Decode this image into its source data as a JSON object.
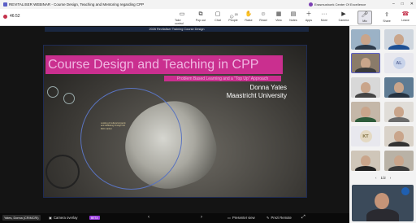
{
  "titlebar": {
    "title": "REVITALISER WEBINAR - Course Design, Teaching and Mentoring regarding CPP",
    "org": "Erasmushoek Center Of Excellence",
    "window_buttons": [
      "–",
      "□",
      "✕"
    ]
  },
  "toolbar": {
    "timer": "46:52",
    "buttons": [
      {
        "label": "Take control",
        "icon": "monitor-icon"
      },
      {
        "label": "Pop out",
        "icon": "popout-icon"
      },
      {
        "label": "Chat",
        "icon": "chat-icon"
      },
      {
        "label": "People",
        "icon": "people-icon",
        "count": "18"
      },
      {
        "label": "Raise",
        "icon": "hand-icon"
      },
      {
        "label": "React",
        "icon": "emoji-icon"
      },
      {
        "label": "View",
        "icon": "grid-icon"
      },
      {
        "label": "Notes",
        "icon": "notes-icon"
      },
      {
        "label": "Apps",
        "icon": "apps-icon"
      },
      {
        "label": "More",
        "icon": "more-icon"
      },
      {
        "label": "Camera",
        "icon": "camera-icon"
      },
      {
        "label": "Mic",
        "icon": "mic-icon"
      },
      {
        "label": "Share",
        "icon": "share-icon"
      },
      {
        "label": "Leave",
        "icon": "phone-icon"
      }
    ]
  },
  "slide": {
    "header": "2026 Revitaliser Training Course Design",
    "title": "Course Design and Teaching in CPP",
    "subtitle": "Problem Based Learning and a \"Top Up\" Approach",
    "speaker_name": "Donna Yates",
    "speaker_affiliation": "Maastricht University",
    "callout": "Looting of cultural property and trafficking through the illicit market"
  },
  "bottom": {
    "presenter_name": "Yates, Donna (CRIMCRI)",
    "camera_overlay": "Camera overlay",
    "beta": "BETA",
    "presenter_view": "Presenter view",
    "prezi_remote": "Prezi Remote"
  },
  "participants": {
    "initials_1": "AL",
    "initials_2": "KT",
    "page": "1/2"
  },
  "colors": {
    "accent": "#5b5fc7",
    "slide_title_bg": "#ca2f8f",
    "slide_title_text": "#f0b6e2",
    "leave": "#c4314b"
  }
}
